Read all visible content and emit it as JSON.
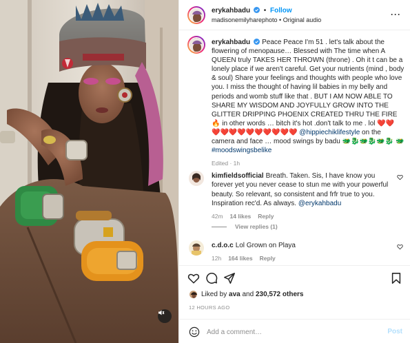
{
  "post": {
    "username": "erykahbadu",
    "follow_label": "Follow",
    "separator": "•",
    "subline": "madisonemilyharephoto • Original audio",
    "more_label": "···"
  },
  "caption": {
    "username": "erykahbadu",
    "text_1": "Peace Peace I'm 51 . let's talk about the flowering of menopause… Blessed with The time when A QUEEN truly TAKES HER THROWN (throne) . Oh it t can be a lonely place if we aren't careful. Get your nutrients (mind , body & soul) Share your feelings and thoughts with people who love you. I miss the thought of having lil babies in my belly and periods and womb stuff like that . BUT I AM NOW ABLE TO SHARE MY WISDOM AND JOYFULLY GROW INTO THE GLITTER DRIPPING PHOENIX CREATED THRU THE FIRE 🔥 in other words … bitch it's hot .don't talk to me . lol ❤️❤️",
    "text_2": "❤️❤️❤️❤️❤️❤️❤️❤️❤️❤️ ",
    "tag_1": "@hippiechiklifestyle",
    "text_3": " on the camera and face … mood swings by badu 🐲🐉🐲🐉🐲🐉",
    "text_4": "🐲 ",
    "tag_2": "#moodswingsbelike",
    "meta": "Edited · 1h"
  },
  "comments": [
    {
      "username": "kimfieldsofficial",
      "text": "Breath. Taken. Sis, I have know you forever yet you never cease to stun me with your powerful beauty. So relevant, so consistent and frfr true to you. Inspiration rec'd. As always. ",
      "mention": "@erykahbadu",
      "time": "42m",
      "likes": "14 likes",
      "reply": "Reply"
    },
    {
      "username": "c.d.o.c",
      "text": "Lol Grown on Playa",
      "time": "12h",
      "likes": "164 likes",
      "reply": "Reply"
    }
  ],
  "view_replies": "View replies (1)",
  "likes_line": {
    "prefix": "Liked by ",
    "user": "ava",
    "middle": " and ",
    "count": "230,572 others"
  },
  "timestamp": "12 HOURS AGO",
  "add_comment": {
    "placeholder": "Add a comment…",
    "post_label": "Post"
  },
  "icons": {
    "verified": "verified-badge-icon",
    "heart": "heart-icon",
    "comment": "comment-icon",
    "share": "share-icon",
    "save": "bookmark-icon",
    "emoji": "emoji-icon",
    "mute": "speaker-icon"
  },
  "colors": {
    "accent": "#0095f6",
    "link": "#00376b",
    "muted": "#8e8e8e",
    "verified": "#3897f0"
  }
}
